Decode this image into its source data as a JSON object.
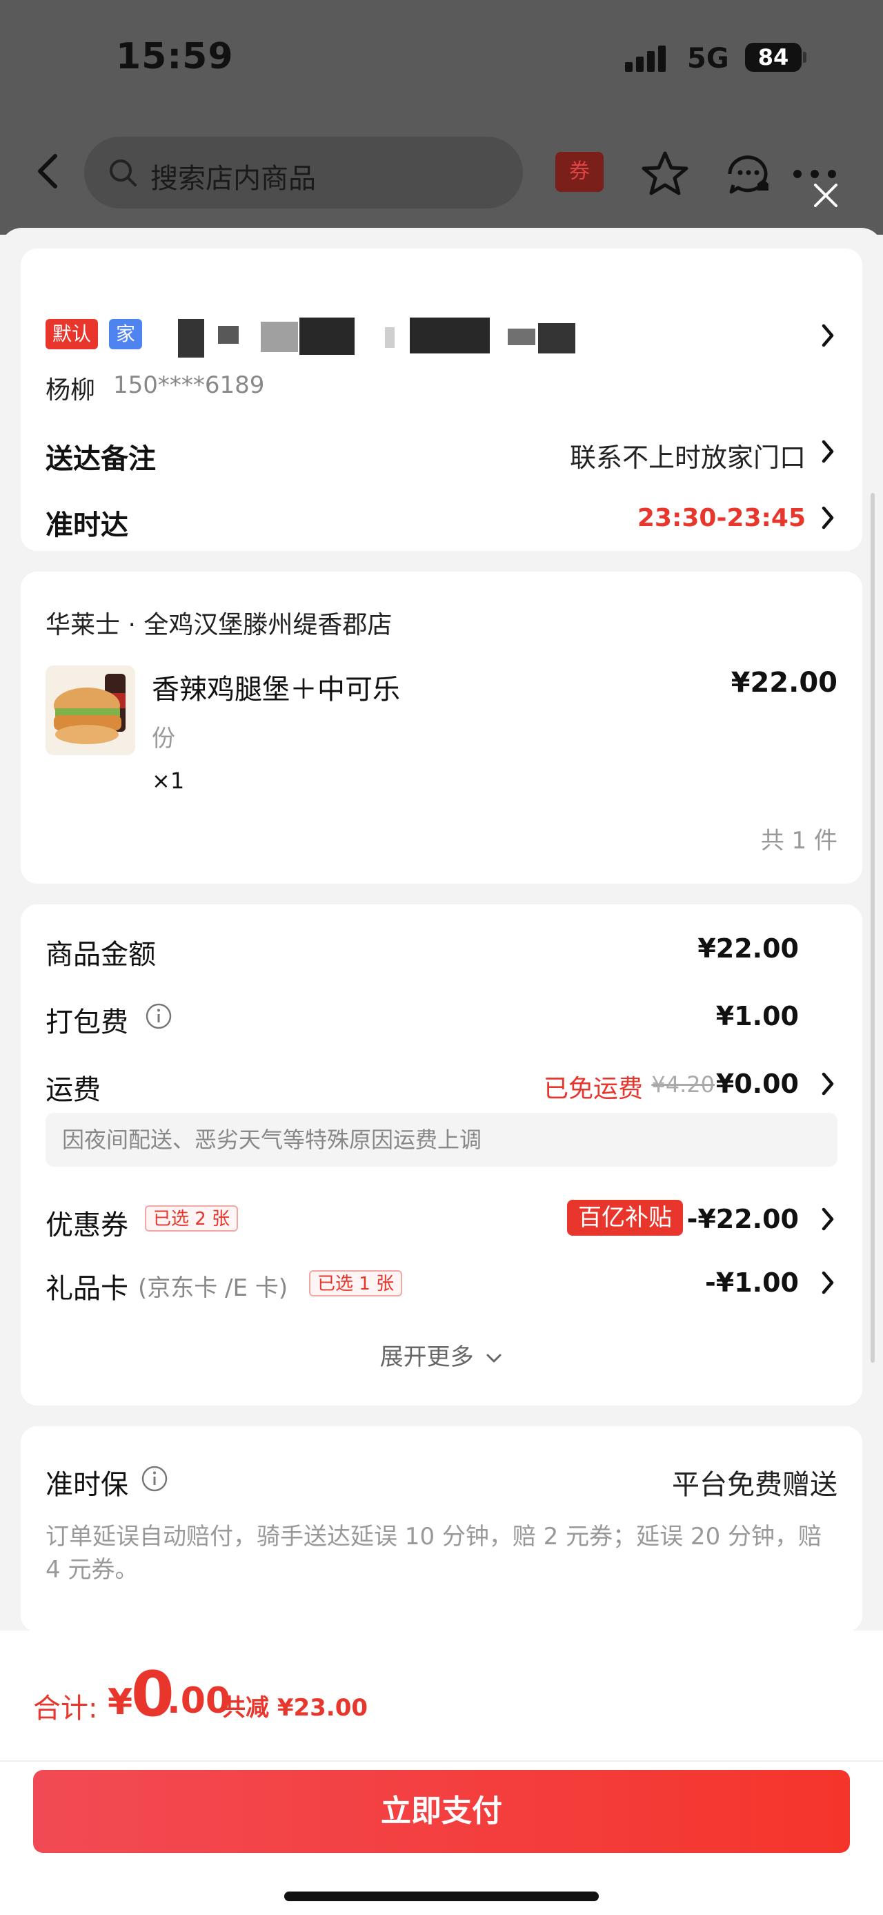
{
  "status_bar": {
    "time": "15:59",
    "network": "5G",
    "battery": "84"
  },
  "navbar": {
    "search_placeholder": "搜索店内商品",
    "coupon_label": "券"
  },
  "address": {
    "tag_default": "默认",
    "tag_home": "家",
    "name": "杨柳",
    "phone": "150****6189",
    "remark_label": "送达备注",
    "remark_value": "联系不上时放家门口",
    "ontime_label": "准时达",
    "ontime_value": "23:30-23:45"
  },
  "store": {
    "name": "华莱士 · 全鸡汉堡滕州缇香郡店",
    "item": {
      "title": "香辣鸡腿堡＋中可乐",
      "unit": "份",
      "qty": "×1",
      "price": "¥22.00"
    },
    "total_count": "共 1 件"
  },
  "fees": {
    "goods_label": "商品金额",
    "goods_value": "¥22.00",
    "pack_label": "打包费",
    "pack_value": "¥1.00",
    "ship_label": "运费",
    "ship_free": "已免运费",
    "ship_original": "¥4.20",
    "ship_value": "¥0.00",
    "notice": "因夜间配送、恶劣天气等特殊原因运费上调",
    "coupon_label": "优惠券",
    "coupon_tag": "已选 2 张",
    "coupon_subsidy": "百亿补贴",
    "coupon_value": "-¥22.00",
    "gift_label": "礼品卡",
    "gift_sub": "(京东卡 /E 卡)",
    "gift_tag": "已选 1 张",
    "gift_value": "-¥1.00",
    "expand": "展开更多"
  },
  "insurance": {
    "title": "准时保",
    "right": "平台免费赠送",
    "desc": "订单延误自动赔付，骑手送达延误 10 分钟，赔 2 元券；延误 20 分钟，赔 4 元券。"
  },
  "bottom": {
    "sum_label": "合计:",
    "sum_yen": "¥",
    "sum_int": "0",
    "sum_dec": ".00",
    "sum_reduce": "共减 ¥23.00",
    "pay_button": "立即支付"
  },
  "colors": {
    "accent_red": "#e8362d",
    "tag_blue": "#4e83f0"
  }
}
